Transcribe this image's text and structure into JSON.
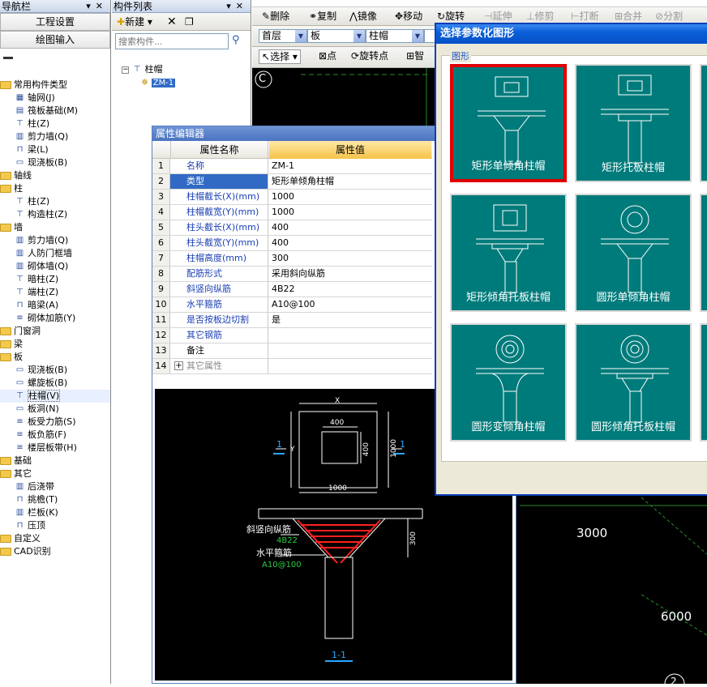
{
  "nav_panel": {
    "title": "导航栏",
    "buttons": [
      "工程设置",
      "绘图输入"
    ],
    "tree": [
      {
        "label": "常用构件类型",
        "kind": "folder",
        "level": 0
      },
      {
        "label": "轴网(J)",
        "kind": "item",
        "level": 1,
        "icon": "grid"
      },
      {
        "label": "筏板基础(M)",
        "kind": "item",
        "level": 1,
        "icon": "raft"
      },
      {
        "label": "柱(Z)",
        "kind": "item",
        "level": 1,
        "icon": "column"
      },
      {
        "label": "剪力墙(Q)",
        "kind": "item",
        "level": 1,
        "icon": "wall"
      },
      {
        "label": "梁(L)",
        "kind": "item",
        "level": 1,
        "icon": "beam"
      },
      {
        "label": "现浇板(B)",
        "kind": "item",
        "level": 1,
        "icon": "slab"
      },
      {
        "label": "轴线",
        "kind": "folder",
        "level": 0
      },
      {
        "label": "柱",
        "kind": "folder",
        "level": 0
      },
      {
        "label": "柱(Z)",
        "kind": "item",
        "level": 1,
        "icon": "column"
      },
      {
        "label": "构造柱(Z)",
        "kind": "item",
        "level": 1,
        "icon": "column"
      },
      {
        "label": "墙",
        "kind": "folder",
        "level": 0
      },
      {
        "label": "剪力墙(Q)",
        "kind": "item",
        "level": 1,
        "icon": "wall"
      },
      {
        "label": "人防门框墙",
        "kind": "item",
        "level": 1,
        "icon": "wall"
      },
      {
        "label": "砌体墙(Q)",
        "kind": "item",
        "level": 1,
        "icon": "wall"
      },
      {
        "label": "暗柱(Z)",
        "kind": "item",
        "level": 1,
        "icon": "column"
      },
      {
        "label": "端柱(Z)",
        "kind": "item",
        "level": 1,
        "icon": "column"
      },
      {
        "label": "暗梁(A)",
        "kind": "item",
        "level": 1,
        "icon": "beam"
      },
      {
        "label": "砌体加筋(Y)",
        "kind": "item",
        "level": 1,
        "icon": "rebar"
      },
      {
        "label": "门窗洞",
        "kind": "folder",
        "level": 0
      },
      {
        "label": "梁",
        "kind": "folder",
        "level": 0
      },
      {
        "label": "板",
        "kind": "folder",
        "level": 0
      },
      {
        "label": "现浇板(B)",
        "kind": "item",
        "level": 1,
        "icon": "slab"
      },
      {
        "label": "螺旋板(B)",
        "kind": "item",
        "level": 1,
        "icon": "slab"
      },
      {
        "label": "柱帽(V)",
        "kind": "item",
        "level": 1,
        "icon": "capital",
        "selected": true
      },
      {
        "label": "板洞(N)",
        "kind": "item",
        "level": 1,
        "icon": "slab"
      },
      {
        "label": "板受力筋(S)",
        "kind": "item",
        "level": 1,
        "icon": "rebar"
      },
      {
        "label": "板负筋(F)",
        "kind": "item",
        "level": 1,
        "icon": "rebar"
      },
      {
        "label": "楼层板带(H)",
        "kind": "item",
        "level": 1,
        "icon": "rebar"
      },
      {
        "label": "基础",
        "kind": "folder",
        "level": 0
      },
      {
        "label": "其它",
        "kind": "folder",
        "level": 0
      },
      {
        "label": "后浇带",
        "kind": "item",
        "level": 1,
        "icon": "wall"
      },
      {
        "label": "挑檐(T)",
        "kind": "item",
        "level": 1,
        "icon": "beam"
      },
      {
        "label": "栏板(K)",
        "kind": "item",
        "level": 1,
        "icon": "wall"
      },
      {
        "label": "压顶",
        "kind": "item",
        "level": 1,
        "icon": "beam"
      },
      {
        "label": "自定义",
        "kind": "folder",
        "level": 0
      },
      {
        "label": "CAD识别",
        "kind": "folder",
        "level": 0
      }
    ]
  },
  "component_panel": {
    "title": "构件列表",
    "new_label": "新建",
    "search_placeholder": "搜索构件...",
    "tree_root": "柱帽",
    "tree_child": "ZM-1"
  },
  "toolbar": {
    "row1": [
      "删除",
      "复制",
      "镜像",
      "移动",
      "旋转",
      "延伸",
      "修剪",
      "打断",
      "合并",
      "分割"
    ],
    "floor": "首层",
    "category": "板",
    "type": "柱帽",
    "select": "选择",
    "point": "点",
    "rotate_point": "旋转点",
    "smart": "智"
  },
  "property_editor": {
    "title": "属性编辑器",
    "col_name": "属性名称",
    "col_value": "属性值",
    "rows": [
      {
        "n": "1",
        "k": "名称",
        "v": "ZM-1"
      },
      {
        "n": "2",
        "k": "类型",
        "v": "矩形单倾角柱帽"
      },
      {
        "n": "3",
        "k": "柱帽截长(X)(mm)",
        "v": "1000"
      },
      {
        "n": "4",
        "k": "柱帽截宽(Y)(mm)",
        "v": "1000"
      },
      {
        "n": "5",
        "k": "柱头截长(X)(mm)",
        "v": "400"
      },
      {
        "n": "6",
        "k": "柱头截宽(Y)(mm)",
        "v": "400"
      },
      {
        "n": "7",
        "k": "柱帽高度(mm)",
        "v": "300"
      },
      {
        "n": "8",
        "k": "配筋形式",
        "v": "采用斜向纵筋"
      },
      {
        "n": "9",
        "k": "斜竖向纵筋",
        "v": "4B22"
      },
      {
        "n": "10",
        "k": "水平箍筋",
        "v": "A10@100"
      },
      {
        "n": "11",
        "k": "是否按板边切割",
        "v": "是"
      },
      {
        "n": "12",
        "k": "其它钢筋",
        "v": ""
      },
      {
        "n": "13",
        "k": "备注",
        "v": ""
      },
      {
        "n": "14",
        "k": "其它属性",
        "v": ""
      }
    ]
  },
  "preview": {
    "dim_x": "X",
    "dim_400_top": "400",
    "dim_400_side": "400",
    "dim_y": "Y",
    "dim_1000_side": "1000",
    "dim_1000_bottom": "1000",
    "sect_left": "1",
    "sect_right": "1",
    "dim_300": "300",
    "label_slant": "斜竖向纵筋",
    "label_slant_val": "4B22",
    "label_hoop": "水平箍筋",
    "label_hoop_val": "A10@100",
    "section_title": "1-1"
  },
  "cad": {
    "axis_label": "C",
    "dim_3000": "3000",
    "dim_6000": "6000",
    "axis_bottom": "2"
  },
  "dialog": {
    "title": "选择参数化图形",
    "group_label": "图形",
    "tiles": [
      "矩形单倾角柱帽",
      "矩形托板柱帽",
      "矩形倾角托板柱帽",
      "圆形单倾角柱帽",
      "圆形变倾角柱帽",
      "圆形倾角托板柱帽"
    ]
  },
  "colors": {
    "tile": "#007b7b",
    "selected": "#e00000",
    "dialog_title": "#0a5fd8"
  }
}
